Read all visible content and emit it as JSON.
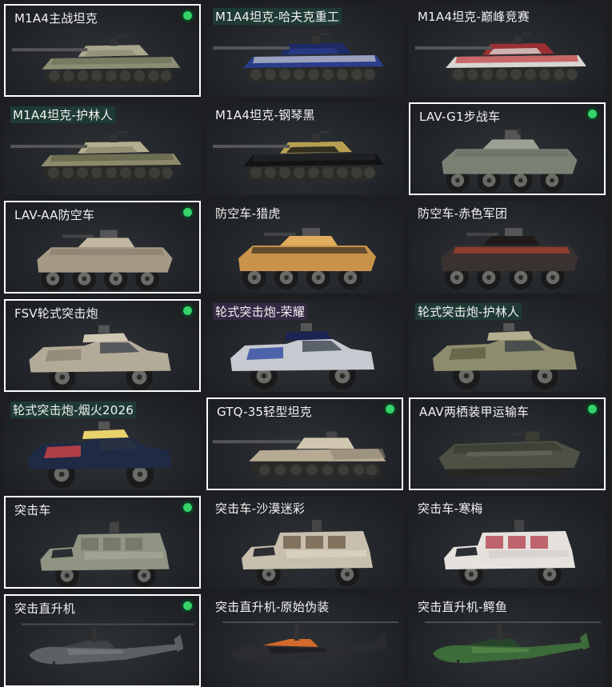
{
  "vehicles": [
    {
      "label": "M1A4主战坦克",
      "selected": true,
      "type": "tank",
      "colors": [
        "#8c8d74",
        "#6e7058",
        "#a9a88e"
      ],
      "label_bg": ""
    },
    {
      "label": "M1A4坦克-哈夫克重工",
      "selected": false,
      "type": "tank",
      "colors": [
        "#2b3c8a",
        "#c9ccd4",
        "#1e2a66"
      ],
      "label_bg": "teal"
    },
    {
      "label": "M1A4坦克-巅峰竞赛",
      "selected": false,
      "type": "tank",
      "colors": [
        "#d9d5d2",
        "#c0383a",
        "#9a3033"
      ],
      "label_bg": ""
    },
    {
      "label": "M1A4坦克-护林人",
      "selected": false,
      "type": "tank",
      "colors": [
        "#8c8a6a",
        "#5f6147",
        "#b3ae8f"
      ],
      "label_bg": "teal"
    },
    {
      "label": "M1A4坦克-钢琴黑",
      "selected": false,
      "type": "tank",
      "colors": [
        "#121314",
        "#242628",
        "#b8a052"
      ],
      "label_bg": ""
    },
    {
      "label": "LAV-G1步战车",
      "selected": true,
      "type": "apc",
      "colors": [
        "#7b8075",
        "#6a6f65",
        "#9aa092"
      ],
      "label_bg": ""
    },
    {
      "label": "LAV-AA防空车",
      "selected": true,
      "type": "aa",
      "colors": [
        "#a59a86",
        "#8a7f6c",
        "#c2b7a1"
      ],
      "label_bg": ""
    },
    {
      "label": "防空车-猎虎",
      "selected": false,
      "type": "aa",
      "colors": [
        "#c9934a",
        "#3a2e20",
        "#e0ad60"
      ],
      "label_bg": ""
    },
    {
      "label": "防空车-赤色军团",
      "selected": false,
      "type": "aa",
      "colors": [
        "#3a3230",
        "#b2402f",
        "#1f1b1a"
      ],
      "label_bg": ""
    },
    {
      "label": "FSV轮式突击炮",
      "selected": true,
      "type": "assault",
      "colors": [
        "#b4aa98",
        "#8f8574",
        "#cfc6b3"
      ],
      "label_bg": ""
    },
    {
      "label": "轮式突击炮-荣耀",
      "selected": false,
      "type": "assault",
      "colors": [
        "#c6c9cf",
        "#2d48a0",
        "#1c2456"
      ],
      "label_bg": "purple"
    },
    {
      "label": "轮式突击炮-护林人",
      "selected": false,
      "type": "assault",
      "colors": [
        "#8d8c6c",
        "#5e5f45",
        "#b2ae8f"
      ],
      "label_bg": "teal"
    },
    {
      "label": "轮式突击炮-烟火2026",
      "selected": false,
      "type": "assault",
      "colors": [
        "#1f2a44",
        "#d4444a",
        "#e8d26a"
      ],
      "label_bg": "teal"
    },
    {
      "label": "GTQ-35轻型坦克",
      "selected": true,
      "type": "lighttank",
      "colors": [
        "#b6aa95",
        "#8e836f",
        "#d1c7b1"
      ],
      "label_bg": ""
    },
    {
      "label": "AAV两栖装甲运输车",
      "selected": true,
      "type": "amphib",
      "colors": [
        "#4d5144",
        "#3a3d33",
        "#6a6e5d"
      ],
      "label_bg": ""
    },
    {
      "label": "突击车",
      "selected": true,
      "type": "truck",
      "colors": [
        "#8f9483",
        "#6c7162",
        "#a9ad9c"
      ],
      "label_bg": ""
    },
    {
      "label": "突击车-沙漠迷彩",
      "selected": false,
      "type": "truck",
      "colors": [
        "#c8bfae",
        "#6b5a44",
        "#e0d8c8"
      ],
      "label_bg": ""
    },
    {
      "label": "突击车-寒梅",
      "selected": false,
      "type": "truck",
      "colors": [
        "#e5e2de",
        "#b23a45",
        "#cfcac4"
      ],
      "label_bg": ""
    },
    {
      "label": "突击直升机",
      "selected": true,
      "type": "heli",
      "colors": [
        "#5c6064",
        "#3f4347",
        "#7a7e82"
      ],
      "label_bg": ""
    },
    {
      "label": "突击直升机-原始伪装",
      "selected": false,
      "type": "heli",
      "colors": [
        "#2a2c30",
        "#d16a2a",
        "#1a1b1e"
      ],
      "label_bg": ""
    },
    {
      "label": "突击直升机-鳄鱼",
      "selected": false,
      "type": "heli",
      "colors": [
        "#3d6b3a",
        "#26452a",
        "#5b8a4f"
      ],
      "label_bg": ""
    }
  ]
}
